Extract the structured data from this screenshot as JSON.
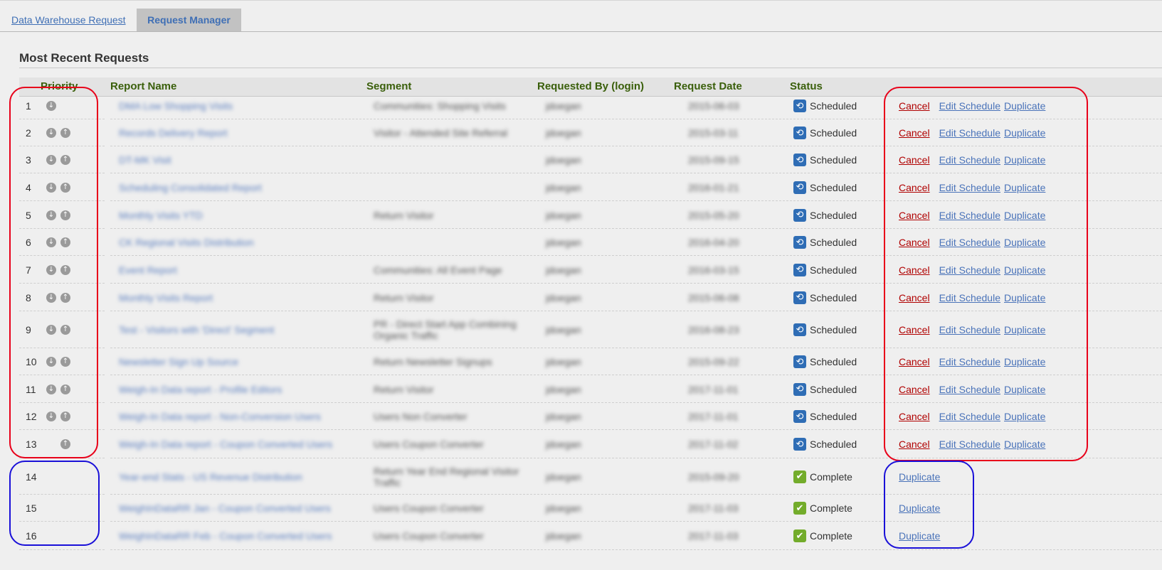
{
  "tabs": [
    {
      "label": "Data Warehouse Request"
    },
    {
      "label": "Request Manager"
    }
  ],
  "section_title": "Most Recent Requests",
  "columns": {
    "priority": "Priority",
    "report_name": "Report Name",
    "segment": "Segment",
    "requested_by": "Requested By (login)",
    "request_date": "Request Date",
    "status": "Status"
  },
  "icons": {
    "move_down": "arrow-down-circle-icon",
    "move_up": "arrow-up-circle-icon",
    "scheduled": "schedule-clock-icon",
    "complete": "checkmark-icon"
  },
  "colors": {
    "header_text": "#3a5f0b",
    "link": "#4a73b9",
    "cancel": "#b00000",
    "scheduled_icon": "#2f6db5",
    "complete_icon": "#73ac2b",
    "highlight_red": "#e8001a",
    "highlight_blue": "#1a10d8"
  },
  "action_labels": {
    "cancel": "Cancel",
    "edit": "Edit Schedule",
    "duplicate": "Duplicate"
  },
  "rows": [
    {
      "priority": "1",
      "report_name": "DMA Low Shopping Visits",
      "segment": "Communities: Shopping Visits",
      "requested_by": "jdoegan",
      "request_date": "2015-06-03",
      "status": "Scheduled"
    },
    {
      "priority": "2",
      "report_name": "Records Delivery Report",
      "segment": "Visitor - Attended Site Referral",
      "requested_by": "jdoegan",
      "request_date": "2015-03-11",
      "status": "Scheduled"
    },
    {
      "priority": "3",
      "report_name": "DT-MK Visit",
      "segment": "",
      "requested_by": "jdoegan",
      "request_date": "2015-09-15",
      "status": "Scheduled"
    },
    {
      "priority": "4",
      "report_name": "Scheduling Consolidated Report",
      "segment": "",
      "requested_by": "jdoegan",
      "request_date": "2016-01-21",
      "status": "Scheduled"
    },
    {
      "priority": "5",
      "report_name": "Monthly Visits YTD",
      "segment": "Return Visitor",
      "requested_by": "jdoegan",
      "request_date": "2015-05-20",
      "status": "Scheduled"
    },
    {
      "priority": "6",
      "report_name": "CK Regional Visits Distribution",
      "segment": "",
      "requested_by": "jdoegan",
      "request_date": "2016-04-20",
      "status": "Scheduled"
    },
    {
      "priority": "7",
      "report_name": "Event Report",
      "segment": "Communities: All Event Page",
      "requested_by": "jdoegan",
      "request_date": "2016-03-15",
      "status": "Scheduled"
    },
    {
      "priority": "8",
      "report_name": "Monthly Visits Report",
      "segment": "Return Visitor",
      "requested_by": "jdoegan",
      "request_date": "2015-06-08",
      "status": "Scheduled"
    },
    {
      "priority": "9",
      "report_name": "Test - Visitors with 'Direct' Segment",
      "segment": "PR - Direct Start App Combining Organic Traffic",
      "requested_by": "jdoegan",
      "request_date": "2016-08-23",
      "status": "Scheduled"
    },
    {
      "priority": "10",
      "report_name": "Newsletter Sign Up Source",
      "segment": "Return Newsletter Signups",
      "requested_by": "jdoegan",
      "request_date": "2015-09-22",
      "status": "Scheduled"
    },
    {
      "priority": "11",
      "report_name": "Weigh-In Data report - Profile Editors",
      "segment": "Return Visitor",
      "requested_by": "jdoegan",
      "request_date": "2017-11-01",
      "status": "Scheduled"
    },
    {
      "priority": "12",
      "report_name": "Weigh-In Data report - Non-Conversion Users",
      "segment": "Users Non Converter",
      "requested_by": "jdoegan",
      "request_date": "2017-11-01",
      "status": "Scheduled"
    },
    {
      "priority": "13",
      "report_name": "Weigh-In Data report - Coupon Converted Users",
      "segment": "Users Coupon Converter",
      "requested_by": "jdoegan",
      "request_date": "2017-11-02",
      "status": "Scheduled"
    },
    {
      "priority": "14",
      "report_name": "Year-end Stats - US Revenue Distribution",
      "segment": "Return Year End Regional Visitor Traffic",
      "requested_by": "jdoegan",
      "request_date": "2015-09-20",
      "status": "Complete"
    },
    {
      "priority": "15",
      "report_name": "WeighInDataRR Jan - Coupon Converted Users",
      "segment": "Users Coupon Converter",
      "requested_by": "jdoegan",
      "request_date": "2017-11-03",
      "status": "Complete"
    },
    {
      "priority": "16",
      "report_name": "WeighInDataRR Feb - Coupon Converted Users",
      "segment": "Users Coupon Converter",
      "requested_by": "jdoegan",
      "request_date": "2017-11-03",
      "status": "Complete"
    }
  ]
}
